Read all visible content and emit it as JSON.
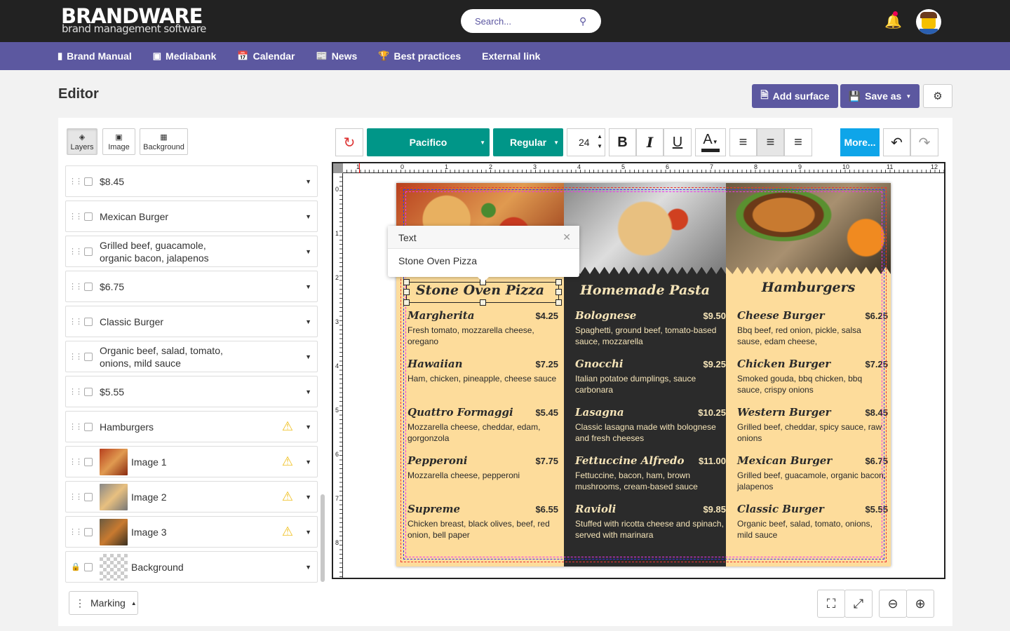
{
  "header": {
    "brand": "BRANDWARE",
    "tagline": "brand management software",
    "search_placeholder": "Search..."
  },
  "nav": [
    {
      "label": "Brand Manual",
      "icon": "book-icon"
    },
    {
      "label": "Mediabank",
      "icon": "image-icon"
    },
    {
      "label": "Calendar",
      "icon": "calendar-icon"
    },
    {
      "label": "News",
      "icon": "newspaper-icon"
    },
    {
      "label": "Best practices",
      "icon": "trophy-icon"
    },
    {
      "label": "External link",
      "icon": ""
    }
  ],
  "page": {
    "title": "Editor",
    "add_surface": "Add surface",
    "save_as": "Save as"
  },
  "side_tabs": {
    "layers": "Layers",
    "image": "Image",
    "background": "Background"
  },
  "layers": [
    {
      "label": "$8.45",
      "warn": false
    },
    {
      "label": "Mexican Burger",
      "warn": false
    },
    {
      "label": "Grilled beef, guacamole,",
      "label2": "organic bacon, jalapenos",
      "warn": false
    },
    {
      "label": "$6.75",
      "warn": false
    },
    {
      "label": "Classic Burger",
      "warn": false
    },
    {
      "label": "Organic beef, salad, tomato,",
      "label2": "onions, mild sauce",
      "warn": false
    },
    {
      "label": "$5.55",
      "warn": false
    },
    {
      "label": "Hamburgers",
      "warn": true
    },
    {
      "label": "Image 1",
      "warn": true,
      "thumb": "pizza"
    },
    {
      "label": "Image 2",
      "warn": true,
      "thumb": "pasta"
    },
    {
      "label": "Image 3",
      "warn": true,
      "thumb": "burger"
    },
    {
      "label": "Background",
      "warn": false,
      "thumb": "transparent",
      "locked": true
    }
  ],
  "marking": "Marking",
  "toolbar": {
    "font": "Pacifico",
    "style": "Regular",
    "size": "24",
    "more": "More...",
    "active_align": "center"
  },
  "ruler": [
    "1",
    "0",
    "1",
    "2",
    "3",
    "4",
    "5",
    "6",
    "7",
    "8",
    "9",
    "10",
    "11",
    "12"
  ],
  "ruler_v": [
    "0",
    "1",
    "2",
    "3",
    "4",
    "5",
    "6",
    "7",
    "8"
  ],
  "popup": {
    "title": "Text",
    "value": "Stone Oven Pizza"
  },
  "menu": {
    "colors": {
      "light": "#fddc9b",
      "dark": "#2b2b2b",
      "ink": "#2b2b2b",
      "cream": "#f5e4b8"
    },
    "columns": [
      {
        "title": "Stone Oven Pizza",
        "items": [
          {
            "name": "Margherita",
            "price": "$4.25",
            "desc": "Fresh tomato, mozzarella cheese, oregano"
          },
          {
            "name": "Hawaiian",
            "price": "$7.25",
            "desc": "Ham, chicken, pineapple, cheese sauce"
          },
          {
            "name": "Quattro Formaggi",
            "price": "$5.45",
            "desc": "Mozzarella cheese, cheddar, edam, gorgonzola"
          },
          {
            "name": "Pepperoni",
            "price": "$7.75",
            "desc": "Mozzarella cheese, pepperoni"
          },
          {
            "name": "Supreme",
            "price": "$6.55",
            "desc": "Chicken breast, black olives, beef, red onion, bell paper"
          }
        ]
      },
      {
        "title": "Homemade Pasta",
        "items": [
          {
            "name": "Bolognese",
            "price": "$9.50",
            "desc": "Spaghetti, ground beef, tomato-based sauce, mozzarella"
          },
          {
            "name": "Gnocchi",
            "price": "$9.25",
            "desc": "Italian potatoe dumplings, sauce carbonara"
          },
          {
            "name": "Lasagna",
            "price": "$10.25",
            "desc": "Classic lasagna made with bolognese and fresh cheeses"
          },
          {
            "name": "Fettuccine Alfredo",
            "price": "$11.00",
            "desc": "Fettuccine, bacon, ham, brown mushrooms, cream-based sauce"
          },
          {
            "name": "Ravioli",
            "price": "$9.85",
            "desc": "Stuffed with ricotta cheese and spinach, served with marinara"
          }
        ]
      },
      {
        "title": "Hamburgers",
        "items": [
          {
            "name": "Cheese Burger",
            "price": "$6.25",
            "desc": "Bbq beef, red onion, pickle, salsa sause, edam cheese,"
          },
          {
            "name": "Chicken Burger",
            "price": "$7.25",
            "desc": "Smoked gouda, bbq chicken, bbq sauce, crispy onions"
          },
          {
            "name": "Western Burger",
            "price": "$8.45",
            "desc": "Grilled beef, cheddar, spicy sauce, raw onions"
          },
          {
            "name": "Mexican Burger",
            "price": "$6.75",
            "desc": "Grilled beef, guacamole, organic bacon, jalapenos"
          },
          {
            "name": "Classic Burger",
            "price": "$5.55",
            "desc": "Organic beef, salad, tomato, onions, mild sauce"
          }
        ]
      }
    ]
  }
}
